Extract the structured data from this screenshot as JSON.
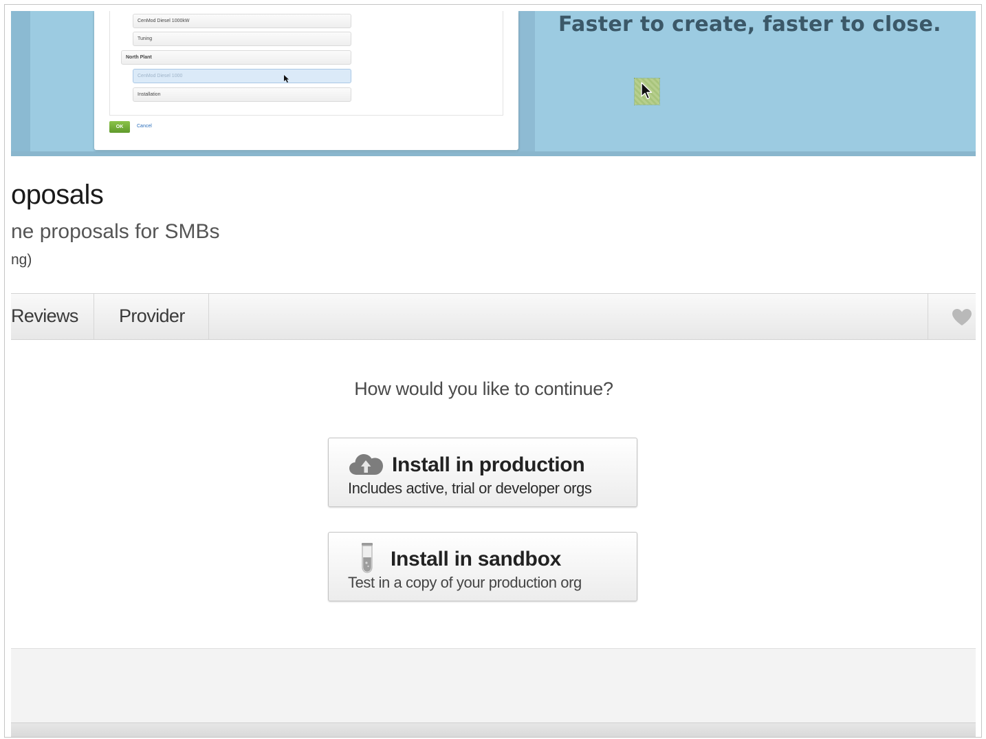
{
  "banner": {
    "tagline": "Faster to create, faster to close.",
    "preview": {
      "rows": [
        "CenMod Diesel 1000kW",
        "Tuning",
        "North Plant",
        "CenMod Diesel 1000",
        "Installation"
      ],
      "ok_label": "OK",
      "cancel_label": "Cancel"
    }
  },
  "app": {
    "title": "oposals",
    "subtitle": "ne proposals for SMBs",
    "meta": "ng)"
  },
  "tabs": {
    "reviews": "Reviews",
    "provider": "Provider",
    "favorite_icon": "heart-icon"
  },
  "main": {
    "question": "How would you like to continue?",
    "production": {
      "icon": "cloud-upload-icon",
      "title": "Install in production",
      "description": "Includes active, trial or developer orgs"
    },
    "sandbox": {
      "icon": "test-tube-icon",
      "title": "Install in sandbox",
      "description": "Test in a copy of your production org"
    }
  },
  "colors": {
    "banner_blue": "#9ccbe1",
    "tagline": "#3b5868",
    "ok_green": "#6aa632",
    "link_blue": "#2a6ebb"
  }
}
